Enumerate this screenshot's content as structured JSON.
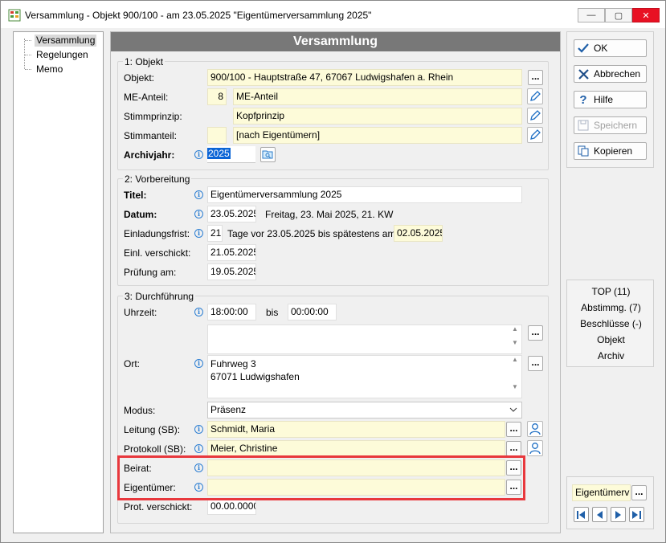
{
  "window": {
    "title": "Versammlung - Objekt 900/100 - am 23.05.2025 \"Eigentümerversammlung 2025\""
  },
  "tree": {
    "items": [
      {
        "label": "Versammlung"
      },
      {
        "label": "Regelungen"
      },
      {
        "label": "Memo"
      }
    ]
  },
  "header": {
    "title": "Versammlung"
  },
  "objekt": {
    "group_title": "1: Objekt",
    "objekt_label": "Objekt:",
    "objekt_value": "900/100 - Hauptstraße 47, 67067 Ludwigshafen a. Rhein",
    "me_label": "ME-Anteil:",
    "me_number": "8",
    "me_value": "ME-Anteil",
    "stimmprinzip_label": "Stimmprinzip:",
    "stimmprinzip_value": "Kopfprinzip",
    "stimmanteil_label": "Stimmanteil:",
    "stimmanteil_value": "[nach Eigentümern]",
    "archivjahr_label": "Archivjahr:",
    "archivjahr_value": "2025"
  },
  "vorbereitung": {
    "group_title": "2: Vorbereitung",
    "titel_label": "Titel:",
    "titel_value": "Eigentümerversammlung 2025",
    "datum_label": "Datum:",
    "datum_value": "23.05.2025",
    "datum_text": "Freitag,  23. Mai 2025,  21. KW",
    "einladung_label": "Einladungsfrist:",
    "einladung_days": "21",
    "einladung_text": "Tage vor 23.05.2025 bis spätestens am",
    "einladung_date": "02.05.2025",
    "verschickt_label": "Einl. verschickt:",
    "verschickt_value": "21.05.2025",
    "pruefung_label": "Prüfung am:",
    "pruefung_value": "19.05.2025"
  },
  "durchfuehrung": {
    "group_title": "3: Durchführung",
    "uhrzeit_label": "Uhrzeit:",
    "uhrzeit_from": "18:00:00",
    "bis_label": "bis",
    "uhrzeit_to": "00:00:00",
    "ort_label": "Ort:",
    "ort_line1": "Fuhrweg 3",
    "ort_line2": "67071 Ludwigshafen",
    "modus_label": "Modus:",
    "modus_value": "Präsenz",
    "leitung_label": "Leitung (SB):",
    "leitung_value": "Schmidt, Maria",
    "protokoll_label": "Protokoll (SB):",
    "protokoll_value": "Meier, Christine",
    "beirat_label": "Beirat:",
    "beirat_value": "",
    "eigentuemer_label": "Eigentümer:",
    "eigentuemer_value": "",
    "prot_verschickt_label": "Prot. verschickt:",
    "prot_verschickt_value": "00.00.0000"
  },
  "actions": {
    "ok": "OK",
    "abbrechen": "Abbrechen",
    "hilfe": "Hilfe",
    "speichern": "Speichern",
    "kopieren": "Kopieren"
  },
  "links": {
    "top": "TOP (11)",
    "abstimmg": "Abstimmg. (7)",
    "beschluesse": "Beschlüsse (-)",
    "objekt": "Objekt",
    "archiv": "Archiv"
  },
  "bottom": {
    "filter": "Eigentümerv"
  },
  "dots": "...",
  "colors": {
    "highlight_border": "#e8383d",
    "required_field": "#fdfbd9",
    "header": "#787878"
  }
}
